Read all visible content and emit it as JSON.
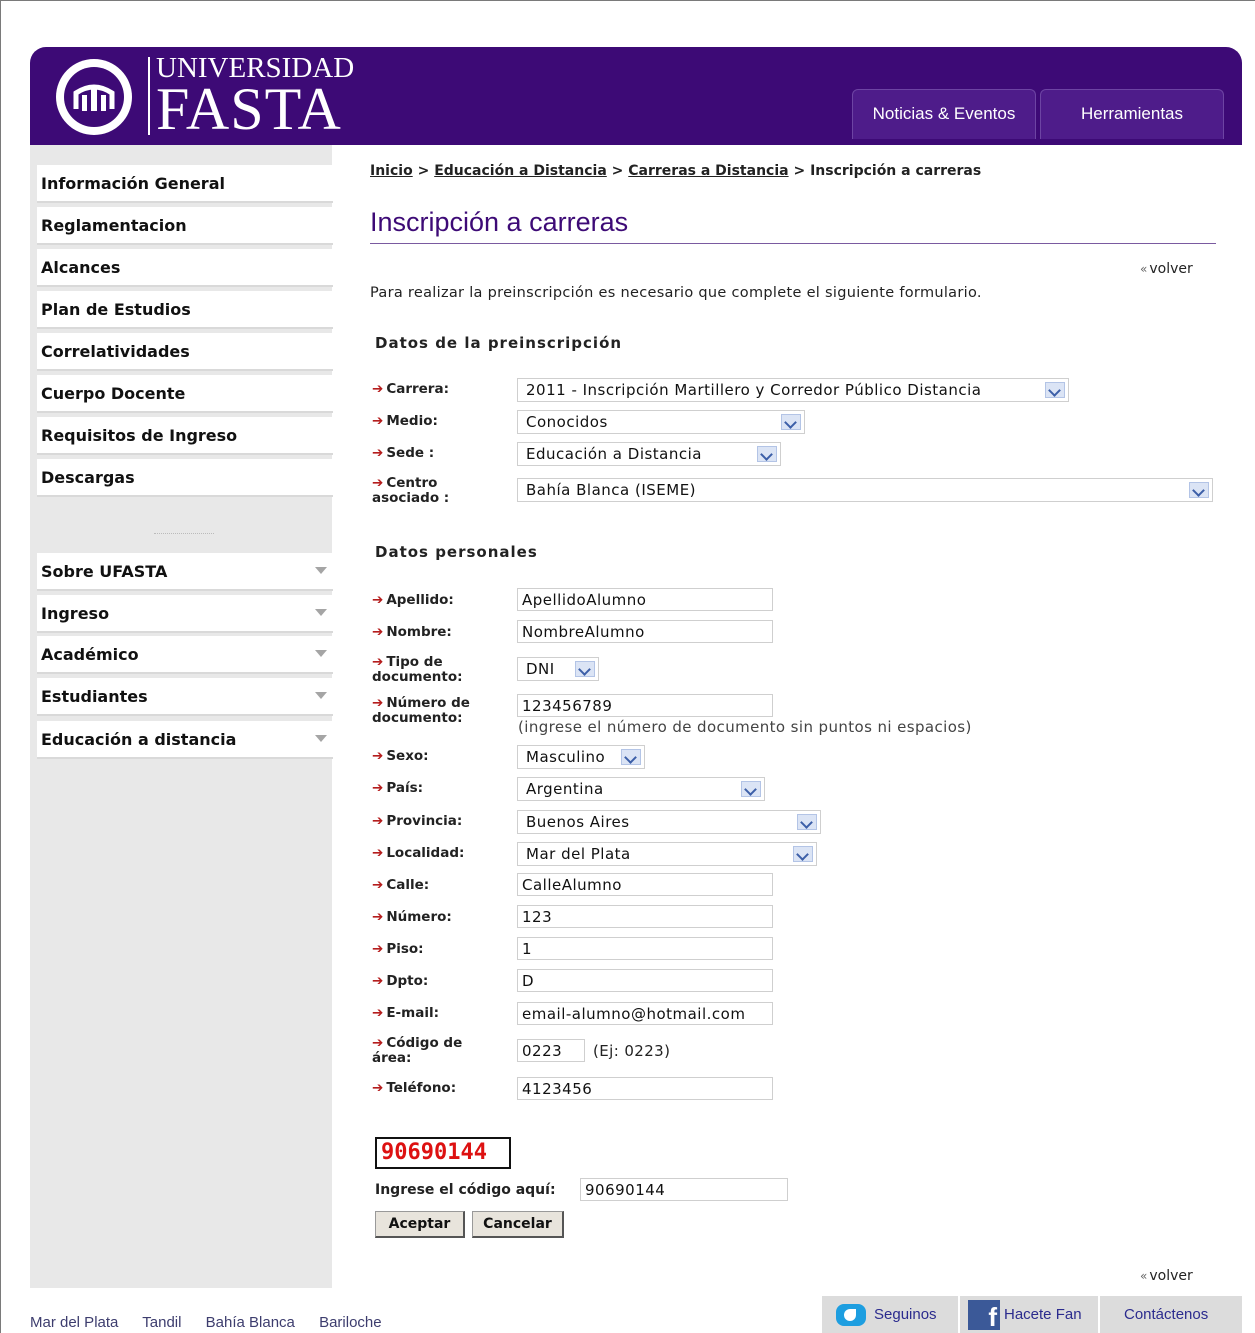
{
  "header": {
    "logo_line1": "UNIVERSIDAD",
    "logo_line2": "FASTA",
    "tabs": [
      {
        "label": "Noticias & Eventos"
      },
      {
        "label": "Herramientas"
      }
    ]
  },
  "sidebar": {
    "items": [
      {
        "label": "Información General"
      },
      {
        "label": "Reglamentacion"
      },
      {
        "label": "Alcances"
      },
      {
        "label": "Plan de Estudios"
      },
      {
        "label": "Correlatividades"
      },
      {
        "label": "Cuerpo Docente"
      },
      {
        "label": "Requisitos de Ingreso"
      },
      {
        "label": "Descargas"
      }
    ],
    "menus": [
      {
        "label": "Sobre UFASTA"
      },
      {
        "label": "Ingreso"
      },
      {
        "label": "Académico"
      },
      {
        "label": "Estudiantes"
      },
      {
        "label": "Educación a distancia"
      }
    ]
  },
  "breadcrumb": {
    "home": "Inicio",
    "sep": ">",
    "edu": "Educación a Distancia",
    "careers": "Carreras a Distancia",
    "current": "Inscripción a carreras"
  },
  "page_title": "Inscripción a carreras",
  "volver": "volver",
  "volver_chevron": "«",
  "intro": "Para realizar la preinscripción es necesario que complete el siguiente formulario.",
  "arrow": "➔",
  "section_preinscripcion": "Datos de la preinscripción",
  "section_personales": "Datos personales",
  "form": {
    "carrera": {
      "label": "Carrera:",
      "value": "2011 - Inscripción Martillero y Corredor Público Distancia"
    },
    "medio": {
      "label": "Medio:",
      "value": "Conocidos"
    },
    "sede": {
      "label": "Sede :",
      "value": "Educación a Distancia"
    },
    "centro": {
      "label_1": "Centro",
      "label_2": "asociado :",
      "value": "Bahía Blanca (ISEME)"
    },
    "apellido": {
      "label": "Apellido:",
      "value": "ApellidoAlumno"
    },
    "nombre": {
      "label": "Nombre:",
      "value": "NombreAlumno"
    },
    "tipo_doc": {
      "label_1": "Tipo de",
      "label_2": "documento:",
      "value": "DNI"
    },
    "num_doc": {
      "label_1": "Número de",
      "label_2": "documento:",
      "value": "123456789",
      "hint": "(ingrese el número de documento sin puntos ni espacios)"
    },
    "sexo": {
      "label": "Sexo:",
      "value": "Masculino"
    },
    "pais": {
      "label": "País:",
      "value": "Argentina"
    },
    "provincia": {
      "label": "Provincia:",
      "value": "Buenos Aires"
    },
    "localidad": {
      "label": "Localidad:",
      "value": "Mar del Plata"
    },
    "calle": {
      "label": "Calle:",
      "value": "CalleAlumno"
    },
    "numero": {
      "label": "Número:",
      "value": "123"
    },
    "piso": {
      "label": "Piso:",
      "value": "1"
    },
    "dpto": {
      "label": "Dpto:",
      "value": "D"
    },
    "email": {
      "label": "E-mail:",
      "value": "email-alumno@hotmail.com"
    },
    "area": {
      "label_1": "Código de",
      "label_2": "área:",
      "value": "0223",
      "hint": "(Ej: 0223)"
    },
    "telefono": {
      "label": "Teléfono:",
      "value": "4123456"
    }
  },
  "captcha": {
    "image_text": "90690144",
    "label": "Ingrese el código aquí:",
    "value": "90690144"
  },
  "buttons": {
    "accept": "Aceptar",
    "cancel": "Cancelar"
  },
  "footer": {
    "links": [
      "Mar del Plata",
      "Tandil",
      "Bahía Blanca",
      "Bariloche"
    ],
    "twitter": "Seguinos",
    "facebook": "Hacete Fan",
    "contact": "Contáctenos"
  }
}
